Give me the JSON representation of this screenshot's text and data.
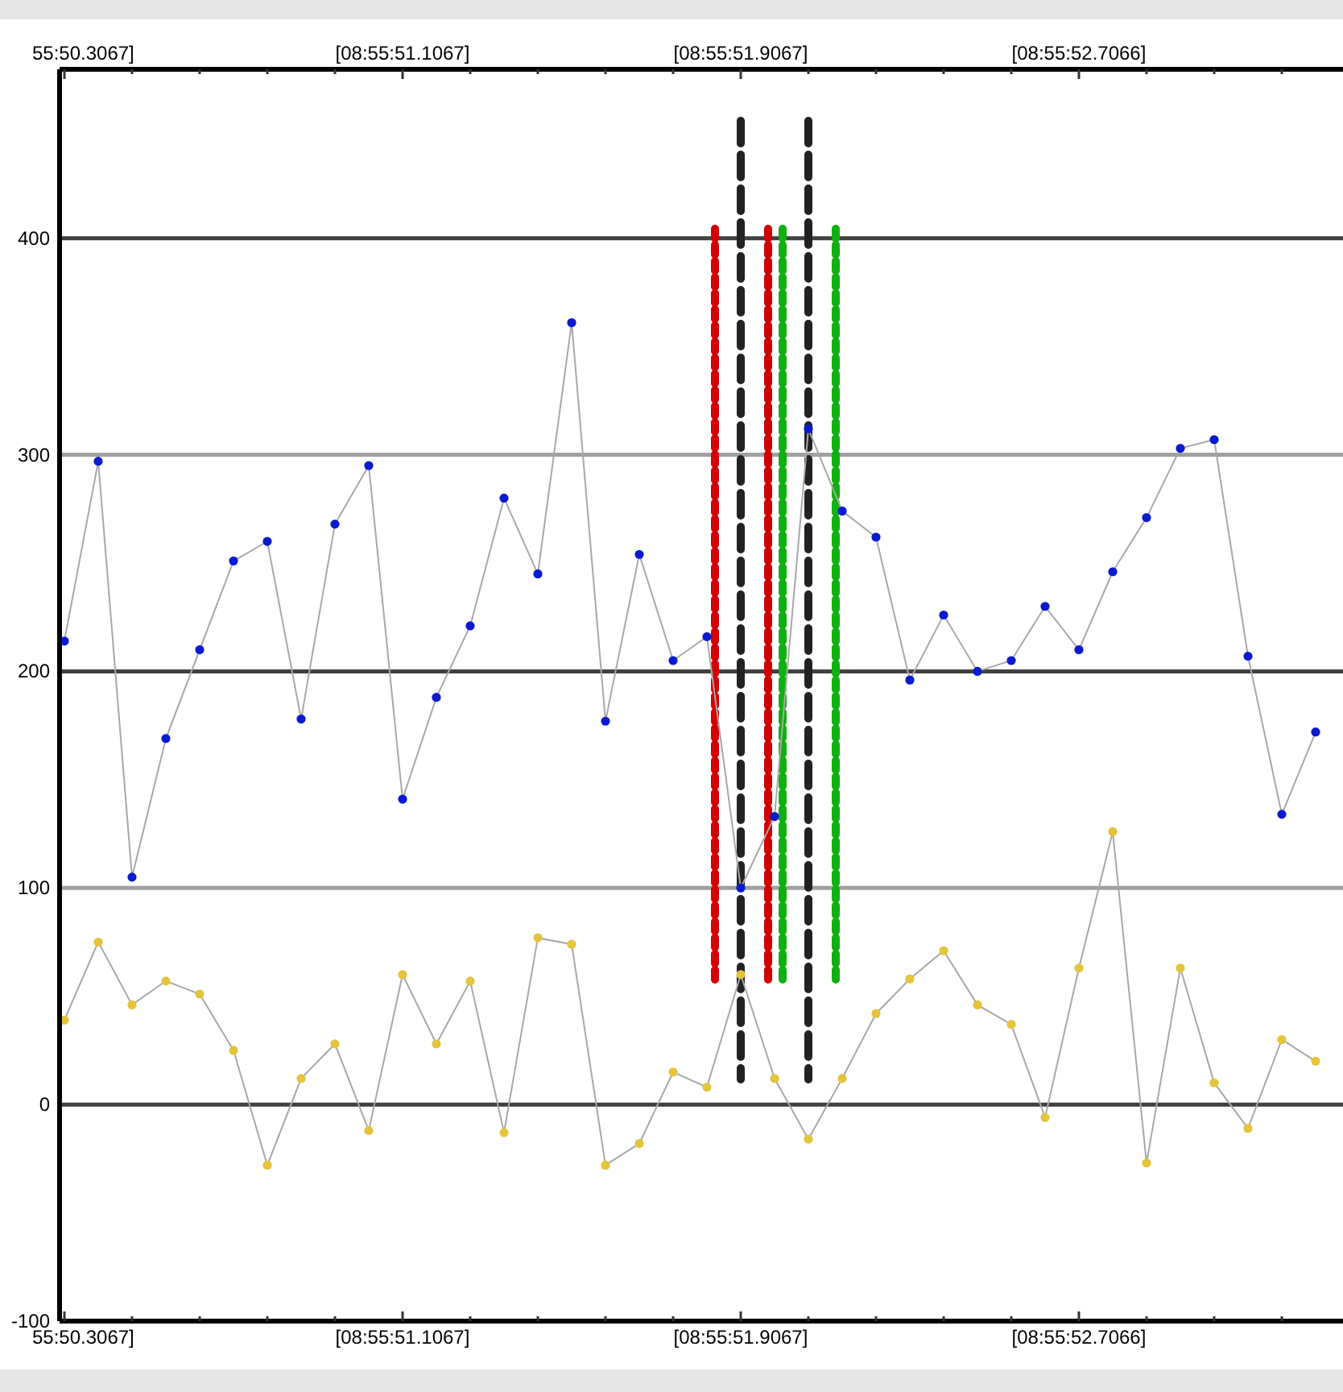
{
  "chart": {
    "chart_data": {
      "type": "line",
      "categories": [
        "55:50.3067]",
        null,
        null,
        null,
        null,
        null,
        null,
        null,
        null,
        null,
        "[08:55:51.1067]",
        null,
        null,
        null,
        null,
        null,
        null,
        null,
        null,
        null,
        "[08:55:51.9067]",
        null,
        null,
        null,
        null,
        null,
        null,
        null,
        null,
        null,
        "[08:55:52.7066]",
        null,
        null,
        null,
        null,
        null,
        null,
        null
      ],
      "series": [
        {
          "color": "#0a1ad0",
          "marker": "circle",
          "values": [
            214,
            297,
            105,
            169,
            210,
            251,
            260,
            178,
            268,
            295,
            141,
            188,
            221,
            280,
            245,
            361,
            177,
            254,
            205,
            216,
            100,
            133,
            312,
            274,
            262,
            196,
            226,
            200,
            205,
            230,
            210,
            246,
            271,
            303,
            307,
            207,
            134,
            172
          ]
        },
        {
          "color": "#e3c43a",
          "marker": "circle",
          "values": [
            39,
            75,
            46,
            57,
            51,
            25,
            -28,
            12,
            28,
            -12,
            60,
            28,
            57,
            -13,
            77,
            74,
            -28,
            -18,
            15,
            8,
            60,
            12,
            -16,
            12,
            42,
            58,
            71,
            46,
            37,
            -6,
            63,
            126,
            -27,
            63,
            10,
            -11,
            30,
            20
          ]
        }
      ],
      "ylim": [
        -100,
        478
      ],
      "yticks": [
        400,
        300,
        200,
        100,
        0,
        -100
      ],
      "grid": true
    }
  }
}
